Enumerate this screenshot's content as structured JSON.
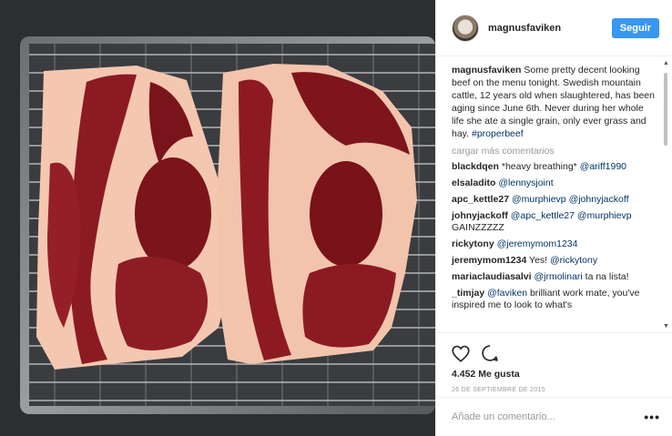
{
  "header": {
    "username": "magnusfaviken",
    "follow_label": "Seguir"
  },
  "caption": {
    "username": "magnusfaviken",
    "text": "Some pretty decent looking beef on the menu tonight. Swedish mountain cattle, 12 years old when slaughtered, has been aging since June 6th. Never during her whole life she ate a single grain, only ever grass and hay.",
    "hashtag": "#properbeef"
  },
  "load_more": "cargar más comentarios",
  "comments": [
    {
      "user": "blackdqen",
      "text": "*heavy breathing* ",
      "mention": "@ariff1990",
      "tail": ""
    },
    {
      "user": "elsaladito",
      "text": "",
      "mention": "@lennysjoint",
      "tail": ""
    },
    {
      "user": "apc_kettle27",
      "text": "",
      "mention": "@murphievp @johnyjackoff",
      "tail": ""
    },
    {
      "user": "johnyjackoff",
      "text": "",
      "mention": "@apc_kettle27 @murphievp",
      "tail": " GAINZZZZZ"
    },
    {
      "user": "rickytony",
      "text": "",
      "mention": "@jeremymom1234",
      "tail": ""
    },
    {
      "user": "jeremymom1234",
      "text": "Yes! ",
      "mention": "@rickytony",
      "tail": ""
    },
    {
      "user": "mariaclaudiasalvi",
      "text": "",
      "mention": "@jrmolinari",
      "tail": " ta na lista!"
    },
    {
      "user": "_timjay",
      "text": "",
      "mention": "@faviken",
      "tail": " brilliant work mate, you've inspired me to look to what's"
    }
  ],
  "actions": {
    "like_icon": "heart-icon",
    "comment_icon": "comment-bubble-icon",
    "likes": "4.452 Me gusta",
    "date": "26 DE SEPTIEMBRE DE 2015"
  },
  "add_comment": {
    "placeholder": "Añade un comentario...",
    "more": "•••"
  },
  "colors": {
    "accent": "#3897f0",
    "link": "#003569",
    "muted": "#999999"
  }
}
